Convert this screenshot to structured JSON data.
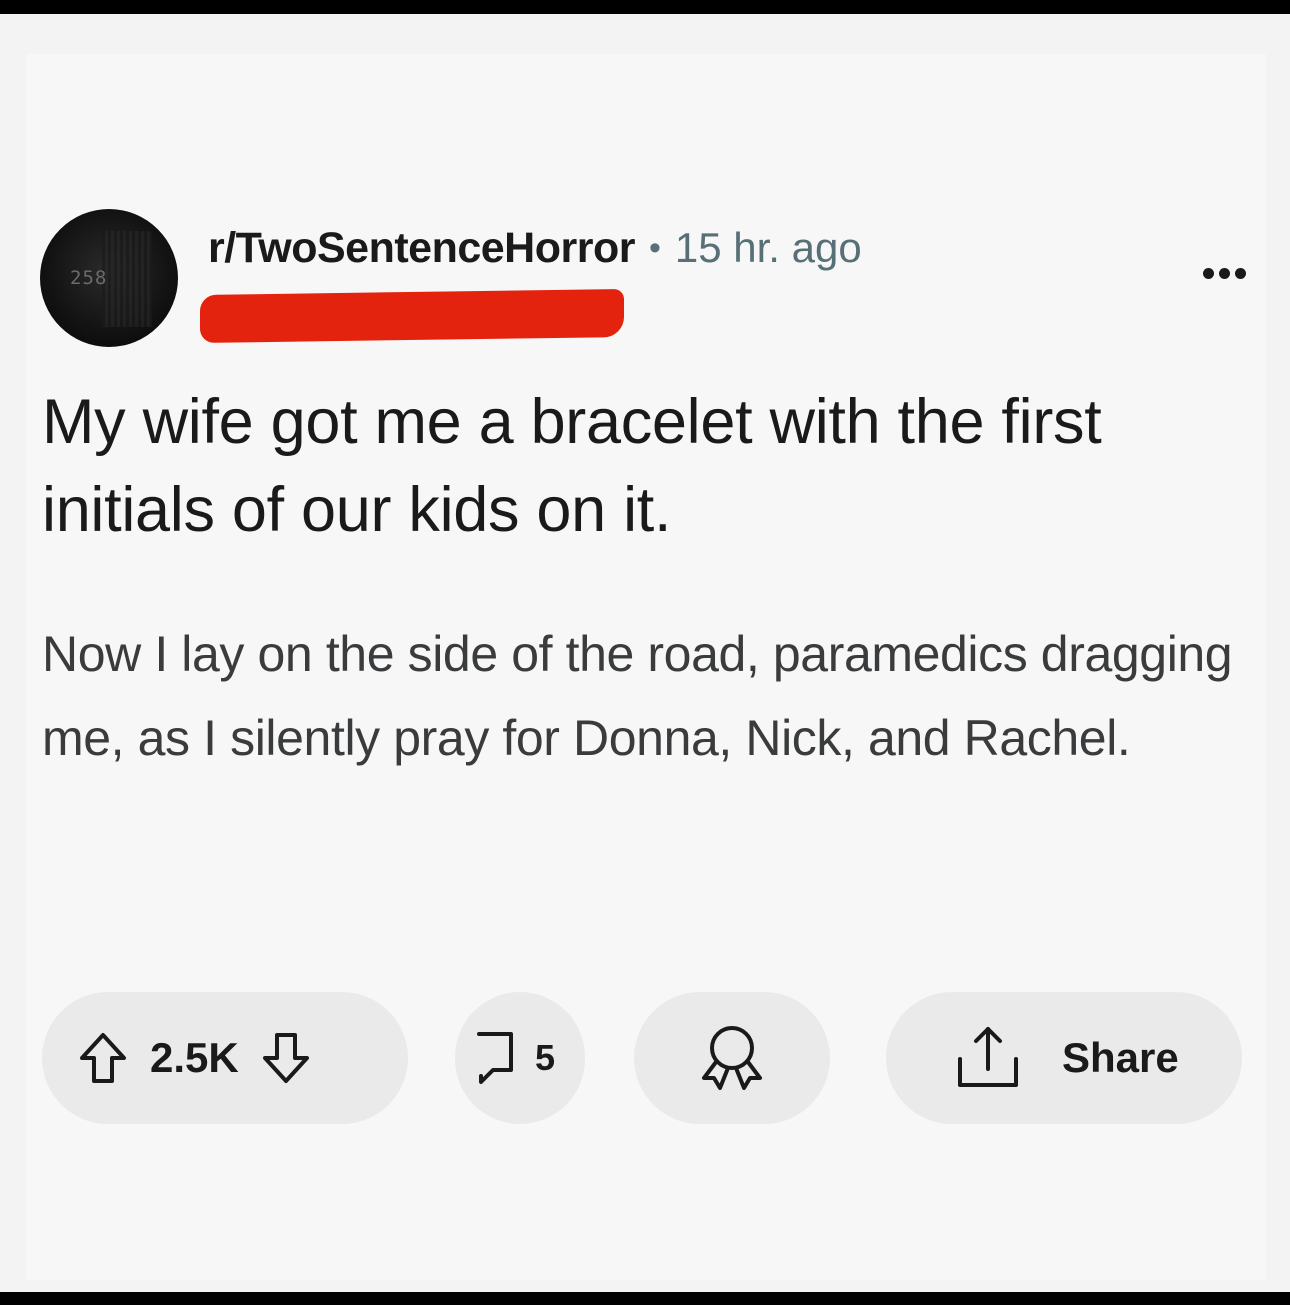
{
  "post": {
    "subreddit": "r/TwoSentenceHorror",
    "separator": "•",
    "time_ago": "15 hr. ago",
    "avatar_text": "258",
    "title": "My wife got me a bracelet with the first initials of our kids on it.",
    "body": "Now I lay on the side of the road, paramedics dragging me, as I silently pray for Donna, Nick, and Rachel."
  },
  "actions": {
    "upvote_icon": "upvote-arrow-icon",
    "vote_count": "2.5K",
    "downvote_icon": "downvote-arrow-icon",
    "comment_icon": "comment-bubble-icon",
    "comment_count": "5",
    "award_icon": "award-ribbon-icon",
    "share_icon": "share-upload-icon",
    "share_label": "Share"
  },
  "colors": {
    "background": "#f7f7f7",
    "text": "#1a1a1b",
    "meta_text": "#576f76",
    "pill": "#eaeaea",
    "redaction": "#e4230f"
  }
}
